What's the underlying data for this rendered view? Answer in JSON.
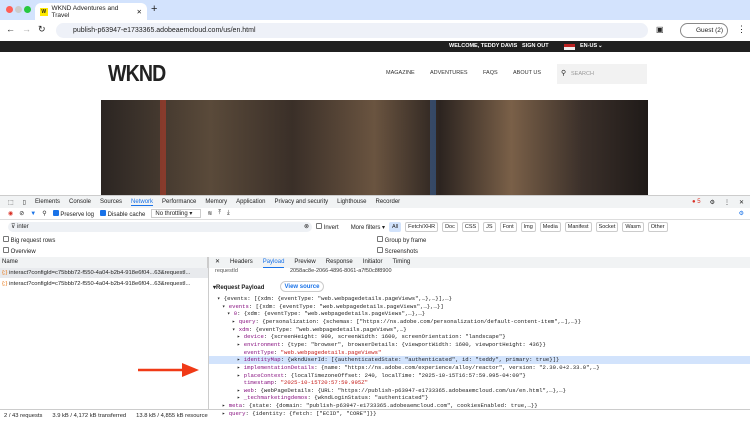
{
  "browser": {
    "tab_title": "WKND Adventures and Travel",
    "favicon": "W",
    "url": "publish-p63947-e1733365.adobeaemcloud.com/us/en.html",
    "profile": "Guest (2)"
  },
  "site": {
    "welcome": "WELCOME, TEDDY DAVIS",
    "sign_out": "SIGN OUT",
    "locale": "EN-US",
    "logo": "WKND",
    "nav": [
      "MAGAZINE",
      "ADVENTURES",
      "FAQS",
      "ABOUT US"
    ],
    "search_placeholder": "SEARCH"
  },
  "devtools": {
    "tabs": [
      "Elements",
      "Console",
      "Sources",
      "Network",
      "Performance",
      "Memory",
      "Application",
      "Privacy and security",
      "Lighthouse",
      "Recorder"
    ],
    "error_count": "5",
    "preserve_log": "Preserve log",
    "disable_cache": "Disable cache",
    "throttling": "No throttling",
    "filter_value": "inter",
    "invert": "Invert",
    "more_filters": "More filters",
    "type_filters": [
      "All",
      "Fetch/XHR",
      "Doc",
      "CSS",
      "JS",
      "Font",
      "Img",
      "Media",
      "Manifest",
      "Socket",
      "Wasm",
      "Other"
    ],
    "big_rows": "Big request rows",
    "overview": "Overview",
    "group_frame": "Group by frame",
    "screenshots": "Screenshots",
    "name_header": "Name",
    "requests": [
      "interact?configId=c75bbb72-f550-4a04-b2b4-918e6f04...63&requestI...",
      "interact?configId=c75bbb72-f550-4a04-b2b4-918e6f04...63&requestI..."
    ],
    "status": {
      "requests": "2 / 43 requests",
      "transferred": "3.9 kB / 4,172 kB transferred",
      "resources": "13.8 kB / 4,855 kB resource"
    },
    "detail_tabs": [
      "Headers",
      "Payload",
      "Preview",
      "Response",
      "Initiator",
      "Timing"
    ],
    "request_id_label": "requestId",
    "request_id": "2058ac8e-2066-4896-8061-a7f50c8f8900",
    "payload_title": "Request Payload",
    "view_source": "View source",
    "lines": [
      {
        "ind": 0,
        "arrow": "▾",
        "key": "",
        "val": "{events: [{xdm: {eventType: \"web.webpagedetails.pageViews\",…},…}],…}"
      },
      {
        "ind": 1,
        "arrow": "▾",
        "key": "events",
        "val": "[{xdm: {eventType: \"web.webpagedetails.pageViews\",…},…}]"
      },
      {
        "ind": 2,
        "arrow": "▾",
        "key": "0",
        "val": "{xdm: {eventType: \"web.webpagedetails.pageViews\",…},…}"
      },
      {
        "ind": 3,
        "arrow": "▸",
        "key": "query",
        "val": "{personalization: {schemas: [\"https://ns.adobe.com/personalization/default-content-item\",…],…}}"
      },
      {
        "ind": 3,
        "arrow": "▾",
        "key": "xdm",
        "val": "{eventType: \"web.webpagedetails.pageViews\",…}"
      },
      {
        "ind": 4,
        "arrow": "▸",
        "key": "device",
        "val": "{screenHeight: 900, screenWidth: 1600, screenOrientation: \"landscape\"}"
      },
      {
        "ind": 4,
        "arrow": "▸",
        "key": "environment",
        "val": "{type: \"browser\", browserDetails: {viewportWidth: 1600, viewportHeight: 436}}"
      },
      {
        "ind": 4,
        "arrow": "",
        "key": "eventType",
        "val": "\"web.webpagedetails.pageViews\"",
        "str": true
      },
      {
        "ind": 4,
        "arrow": "▸",
        "key": "identityMap",
        "val": "{wkndUserId: [{authenticatedState: \"authenticated\", id: \"teddy\", primary: true}]}",
        "hl": true
      },
      {
        "ind": 4,
        "arrow": "▸",
        "key": "implementationDetails",
        "val": "{name: \"https://ns.adobe.com/experience/alloy/reactor\", version: \"2.30.0+2.33.0\",…}"
      },
      {
        "ind": 4,
        "arrow": "▸",
        "key": "placeContext",
        "val": "{localTimezoneOffset: 240, localTime: \"2025-10-15T16:57:59.995-04:00\"}"
      },
      {
        "ind": 4,
        "arrow": "",
        "key": "timestamp",
        "val": "\"2025-10-15T20:57:59.995Z\"",
        "str": true
      },
      {
        "ind": 4,
        "arrow": "▸",
        "key": "web",
        "val": "{webPageDetails: {URL: \"https://publish-p63947-e1733365.adobeaemcloud.com/us/en.html\",…},…}"
      },
      {
        "ind": 4,
        "arrow": "▸",
        "key": "_techmarketingdemos",
        "val": "{wkndLoginStatus: \"authenticated\"}"
      },
      {
        "ind": 1,
        "arrow": "▸",
        "key": "meta",
        "val": "{state: {domain: \"publish-p63947-e1733365.adobeaemcloud.com\", cookiesEnabled: true,…}}"
      },
      {
        "ind": 1,
        "arrow": "▸",
        "key": "query",
        "val": "{identity: {fetch: [\"ECID\", \"CORE\"]}}"
      }
    ]
  },
  "colors": {
    "accent": "#1a73e8",
    "arrow": "#f03a17",
    "highlight": "#d2e3fc"
  }
}
